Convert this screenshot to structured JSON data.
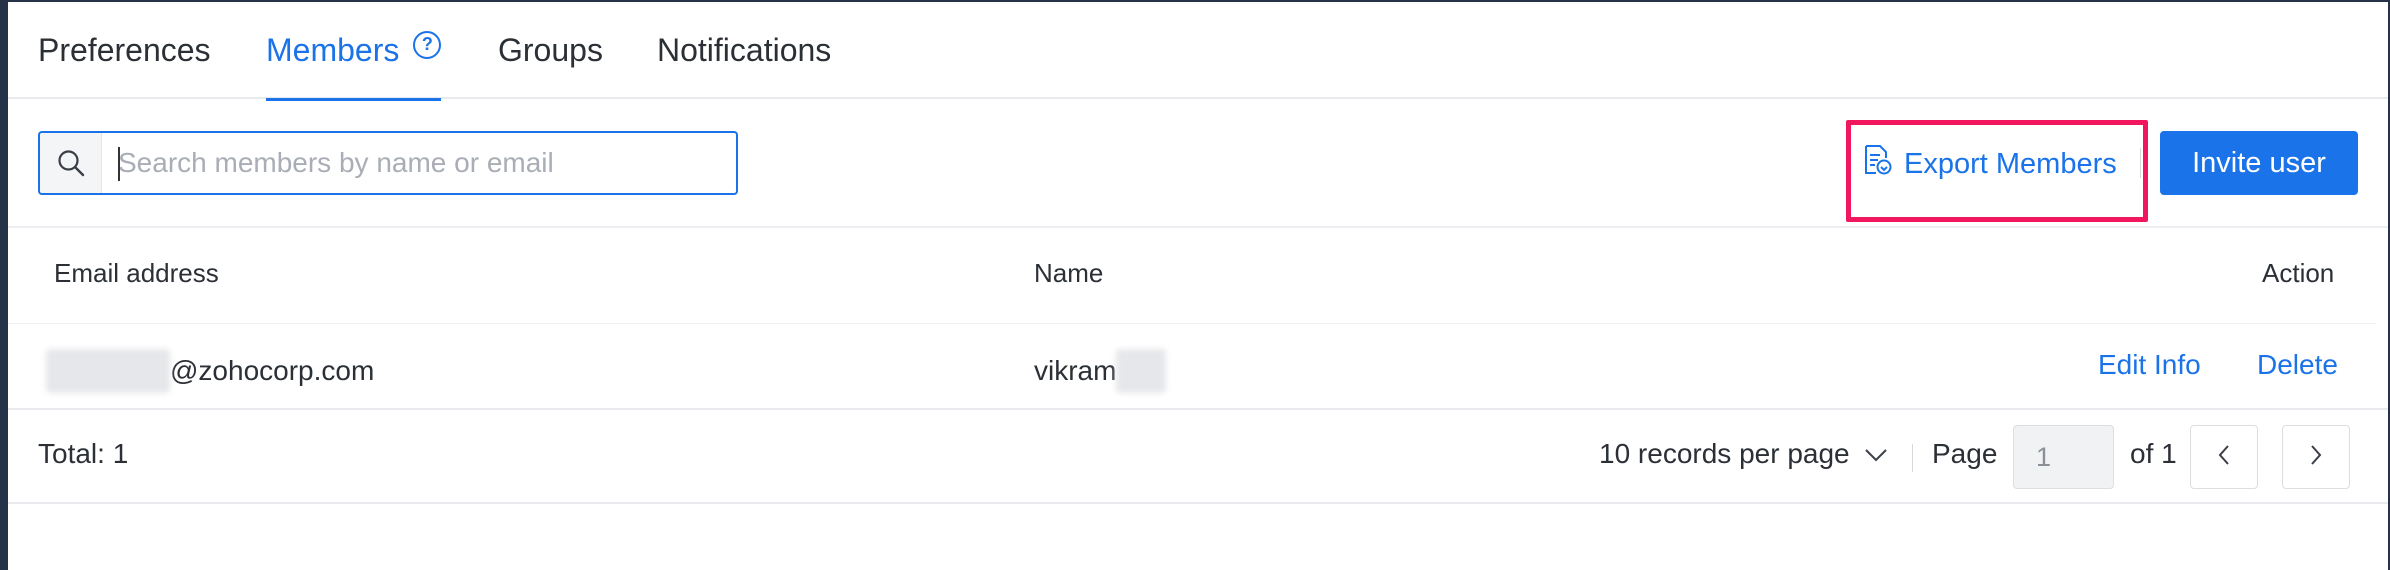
{
  "tabs": [
    {
      "label": "Preferences",
      "active": false
    },
    {
      "label": "Members",
      "active": true
    },
    {
      "label": "Groups",
      "active": false
    },
    {
      "label": "Notifications",
      "active": false
    }
  ],
  "help_icon_glyph": "?",
  "search": {
    "placeholder": "Search members by name or email",
    "value": ""
  },
  "toolbar": {
    "export_label": "Export Members",
    "invite_label": "Invite user"
  },
  "table": {
    "columns": {
      "email": "Email address",
      "name": "Name",
      "action": "Action"
    },
    "rows": [
      {
        "email_domain": "@zohocorp.com",
        "name": "vikram",
        "actions": {
          "edit": "Edit Info",
          "delete": "Delete"
        }
      }
    ]
  },
  "footer": {
    "total": "Total: 1",
    "per_page": "10 records per page",
    "page_label": "Page",
    "page_value": "1",
    "of_label": "of 1"
  },
  "colors": {
    "accent": "#1a73e8",
    "highlight": "#f0175e",
    "text": "#2b2f36"
  }
}
